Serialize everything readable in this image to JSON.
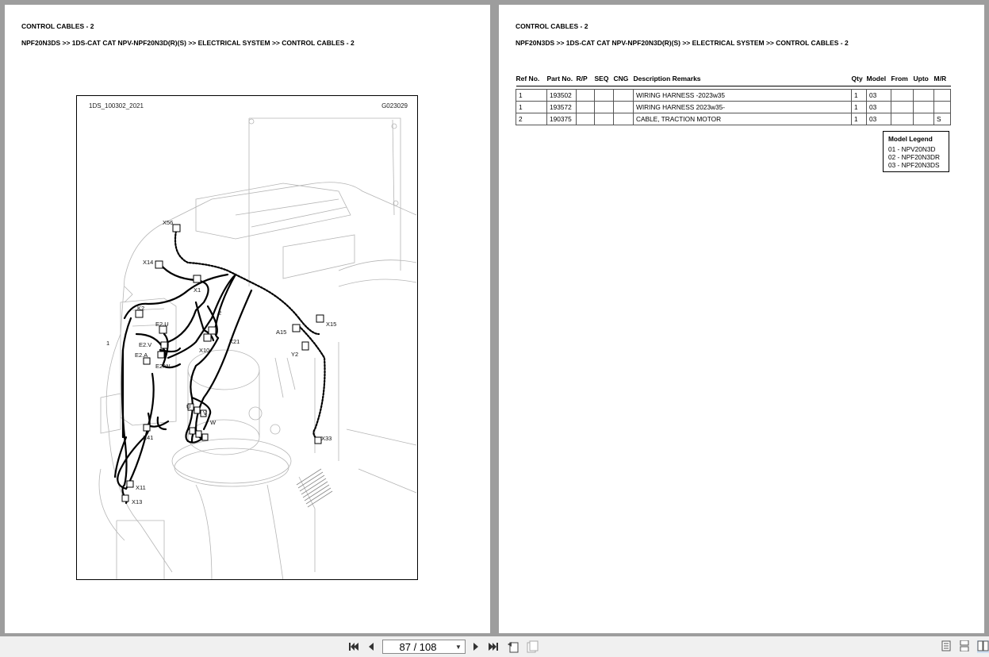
{
  "left_page": {
    "title": "CONTROL CABLES - 2",
    "breadcrumb": "NPF20N3DS >> 1DS-CAT CAT NPV-NPF20N3D(R)(S) >> ELECTRICAL SYSTEM >> CONTROL CABLES - 2",
    "diagram": {
      "id_left": "1DS_100302_2021",
      "id_right": "G023029",
      "callouts": {
        "x56": "X56",
        "x14": "X14",
        "x1": "X1",
        "k2": "K2",
        "e2u": "E2.U",
        "e2v": "E2.V",
        "e2a": "E2.A",
        "e2w": "E2.W",
        "ref1": "1",
        "ref2": "2",
        "x10": "X10",
        "x21": "X21",
        "a15": "A15",
        "x15": "X15",
        "y2": "Y2",
        "u": "U",
        "v": "V",
        "w": "W",
        "x41": "X41",
        "x33": "X33",
        "x11": "X11",
        "x13": "X13"
      }
    }
  },
  "right_page": {
    "title": "CONTROL CABLES - 2",
    "breadcrumb": "NPF20N3DS >> 1DS-CAT CAT NPV-NPF20N3D(R)(S) >> ELECTRICAL SYSTEM >> CONTROL CABLES - 2",
    "table": {
      "headers": [
        "Ref No.",
        "Part No.",
        "R/P",
        "SEQ",
        "CNG",
        "Description Remarks",
        "Qty",
        "Model",
        "From",
        "Upto",
        "M/R"
      ],
      "rows": [
        [
          "1",
          "193502",
          "",
          "",
          "",
          "WIRING HARNESS -2023w35",
          "1",
          "03",
          "",
          "",
          ""
        ],
        [
          "1",
          "193572",
          "",
          "",
          "",
          "WIRING HARNESS 2023w35-",
          "1",
          "03",
          "",
          "",
          ""
        ],
        [
          "2",
          "190375",
          "",
          "",
          "",
          "CABLE, TRACTION MOTOR",
          "1",
          "03",
          "",
          "",
          "S"
        ]
      ]
    },
    "model_legend": {
      "title": "Model Legend",
      "items": [
        "01 - NPV20N3D",
        "02 - NPF20N3DR",
        "03 - NPF20N3DS"
      ]
    }
  },
  "toolbar": {
    "page_indicator": "87 / 108",
    "icons": {
      "first": "first-page-icon",
      "prev": "prev-page-icon",
      "next": "next-page-icon",
      "last": "last-page-icon",
      "back": "back-view-icon",
      "forward": "forward-view-icon",
      "single": "single-page-view-icon",
      "continuous": "continuous-view-icon",
      "facing": "facing-pages-view-icon"
    }
  }
}
